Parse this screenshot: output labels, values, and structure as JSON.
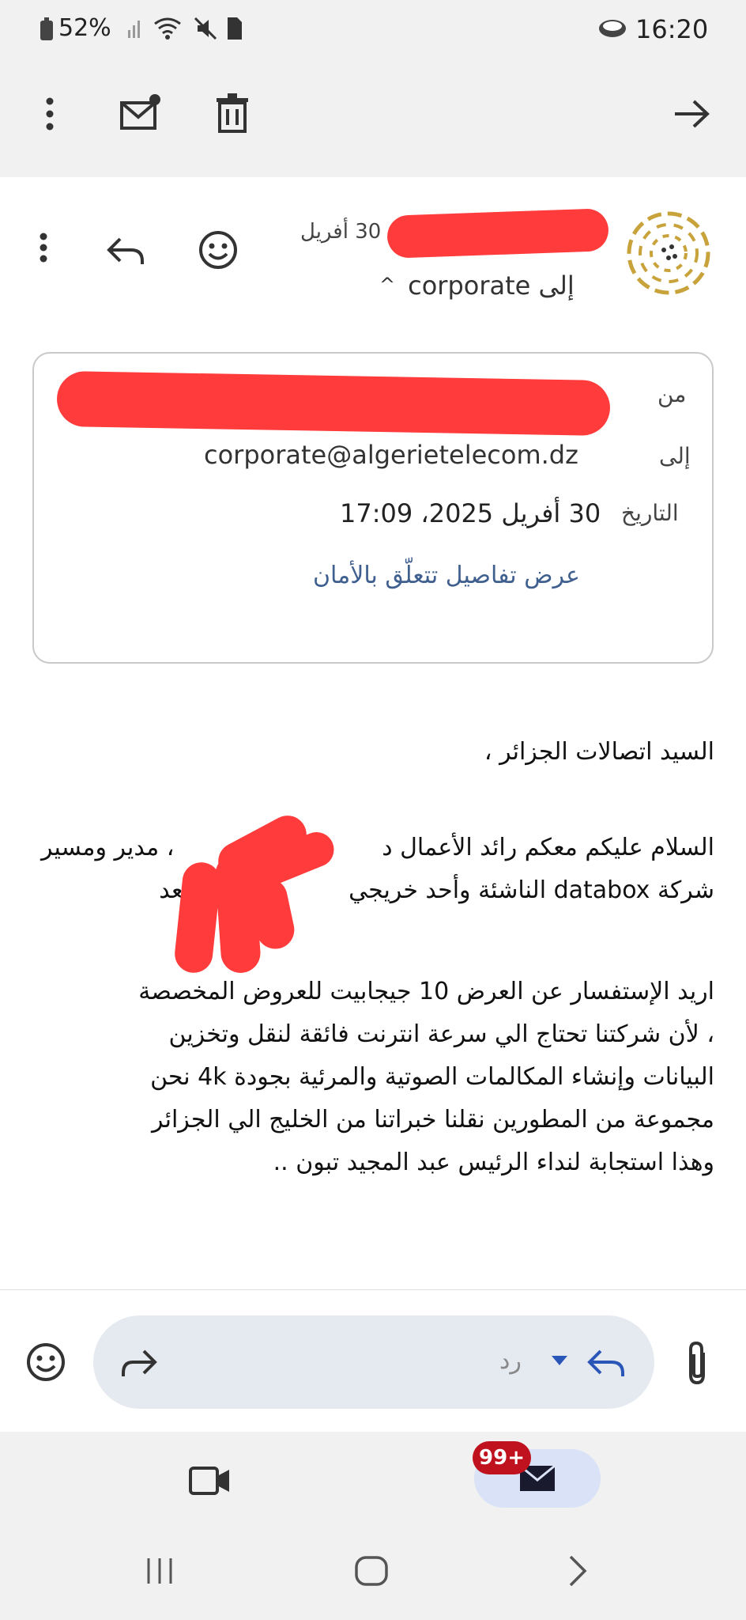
{
  "status_bar": {
    "battery": "52%",
    "time": "16:20"
  },
  "toolbar": {
    "icons": [
      "more-vert-icon",
      "mark-unread-icon",
      "delete-icon",
      "forward-arrow-icon"
    ]
  },
  "email_header": {
    "date_short": "30 أفريل",
    "recipient_summary": "إلى corporate",
    "chevron": "^"
  },
  "details_card": {
    "from_label": "من",
    "to_label": "إلى",
    "to_value": "corporate@algerietelecom.dz",
    "date_label": "التاريخ",
    "date_value": "30 أفريل 2025، 17:09",
    "security_link": "عرض تفاصيل تتعلّق بالأمان"
  },
  "body": {
    "greeting": "السيد اتصالات الجزائر ،",
    "para1_line1_part1": "السلام عليكم معكم رائد الأعمال د",
    "para1_line1_part2": "، مدير ومسير",
    "para1_line2_part1": "شركة",
    "para1_line2_company": "databox",
    "para1_line2_part2": "الناشئة وأحد خريجي",
    "para1_line2_part3": "..أما بعد",
    "para2_line1": "اريد الإستفسار عن العرض 10 جيجابيت للعروض المخصصة",
    "para2_line2": "، لأن شركتنا تحتاج الي سرعة انترنت فائقة لنقل وتخزين",
    "para2_line3": "البيانات وإنشاء المكالمات الصوتية والمرئية بجودة 4k نحن",
    "para2_line4": "مجموعة من المطورين نقلنا خبراتنا من الخليج الي الجزائر",
    "para2_line5": "وهذا استجابة لنداء الرئيس عبد المجيد تبون  .."
  },
  "composer": {
    "reply_label": "رد"
  },
  "bottom_nav": {
    "badge": "99+"
  },
  "colors": {
    "redaction": "#ff3b3b",
    "link": "#3f5f8f",
    "badge": "#c0111f",
    "avatar_gold": "#c8a23a"
  }
}
